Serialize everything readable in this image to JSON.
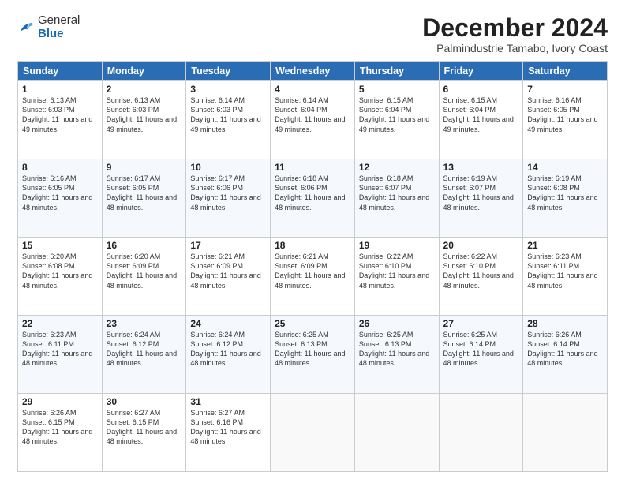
{
  "logo": {
    "general": "General",
    "blue": "Blue"
  },
  "header": {
    "title": "December 2024",
    "subtitle": "Palmindustrie Tamabo, Ivory Coast"
  },
  "weekdays": [
    "Sunday",
    "Monday",
    "Tuesday",
    "Wednesday",
    "Thursday",
    "Friday",
    "Saturday"
  ],
  "weeks": [
    [
      {
        "day": "1",
        "sunrise": "6:13 AM",
        "sunset": "6:03 PM",
        "daylight": "11 hours and 49 minutes."
      },
      {
        "day": "2",
        "sunrise": "6:13 AM",
        "sunset": "6:03 PM",
        "daylight": "11 hours and 49 minutes."
      },
      {
        "day": "3",
        "sunrise": "6:14 AM",
        "sunset": "6:03 PM",
        "daylight": "11 hours and 49 minutes."
      },
      {
        "day": "4",
        "sunrise": "6:14 AM",
        "sunset": "6:04 PM",
        "daylight": "11 hours and 49 minutes."
      },
      {
        "day": "5",
        "sunrise": "6:15 AM",
        "sunset": "6:04 PM",
        "daylight": "11 hours and 49 minutes."
      },
      {
        "day": "6",
        "sunrise": "6:15 AM",
        "sunset": "6:04 PM",
        "daylight": "11 hours and 49 minutes."
      },
      {
        "day": "7",
        "sunrise": "6:16 AM",
        "sunset": "6:05 PM",
        "daylight": "11 hours and 49 minutes."
      }
    ],
    [
      {
        "day": "8",
        "sunrise": "6:16 AM",
        "sunset": "6:05 PM",
        "daylight": "11 hours and 48 minutes."
      },
      {
        "day": "9",
        "sunrise": "6:17 AM",
        "sunset": "6:05 PM",
        "daylight": "11 hours and 48 minutes."
      },
      {
        "day": "10",
        "sunrise": "6:17 AM",
        "sunset": "6:06 PM",
        "daylight": "11 hours and 48 minutes."
      },
      {
        "day": "11",
        "sunrise": "6:18 AM",
        "sunset": "6:06 PM",
        "daylight": "11 hours and 48 minutes."
      },
      {
        "day": "12",
        "sunrise": "6:18 AM",
        "sunset": "6:07 PM",
        "daylight": "11 hours and 48 minutes."
      },
      {
        "day": "13",
        "sunrise": "6:19 AM",
        "sunset": "6:07 PM",
        "daylight": "11 hours and 48 minutes."
      },
      {
        "day": "14",
        "sunrise": "6:19 AM",
        "sunset": "6:08 PM",
        "daylight": "11 hours and 48 minutes."
      }
    ],
    [
      {
        "day": "15",
        "sunrise": "6:20 AM",
        "sunset": "6:08 PM",
        "daylight": "11 hours and 48 minutes."
      },
      {
        "day": "16",
        "sunrise": "6:20 AM",
        "sunset": "6:09 PM",
        "daylight": "11 hours and 48 minutes."
      },
      {
        "day": "17",
        "sunrise": "6:21 AM",
        "sunset": "6:09 PM",
        "daylight": "11 hours and 48 minutes."
      },
      {
        "day": "18",
        "sunrise": "6:21 AM",
        "sunset": "6:09 PM",
        "daylight": "11 hours and 48 minutes."
      },
      {
        "day": "19",
        "sunrise": "6:22 AM",
        "sunset": "6:10 PM",
        "daylight": "11 hours and 48 minutes."
      },
      {
        "day": "20",
        "sunrise": "6:22 AM",
        "sunset": "6:10 PM",
        "daylight": "11 hours and 48 minutes."
      },
      {
        "day": "21",
        "sunrise": "6:23 AM",
        "sunset": "6:11 PM",
        "daylight": "11 hours and 48 minutes."
      }
    ],
    [
      {
        "day": "22",
        "sunrise": "6:23 AM",
        "sunset": "6:11 PM",
        "daylight": "11 hours and 48 minutes."
      },
      {
        "day": "23",
        "sunrise": "6:24 AM",
        "sunset": "6:12 PM",
        "daylight": "11 hours and 48 minutes."
      },
      {
        "day": "24",
        "sunrise": "6:24 AM",
        "sunset": "6:12 PM",
        "daylight": "11 hours and 48 minutes."
      },
      {
        "day": "25",
        "sunrise": "6:25 AM",
        "sunset": "6:13 PM",
        "daylight": "11 hours and 48 minutes."
      },
      {
        "day": "26",
        "sunrise": "6:25 AM",
        "sunset": "6:13 PM",
        "daylight": "11 hours and 48 minutes."
      },
      {
        "day": "27",
        "sunrise": "6:25 AM",
        "sunset": "6:14 PM",
        "daylight": "11 hours and 48 minutes."
      },
      {
        "day": "28",
        "sunrise": "6:26 AM",
        "sunset": "6:14 PM",
        "daylight": "11 hours and 48 minutes."
      }
    ],
    [
      {
        "day": "29",
        "sunrise": "6:26 AM",
        "sunset": "6:15 PM",
        "daylight": "11 hours and 48 minutes."
      },
      {
        "day": "30",
        "sunrise": "6:27 AM",
        "sunset": "6:15 PM",
        "daylight": "11 hours and 48 minutes."
      },
      {
        "day": "31",
        "sunrise": "6:27 AM",
        "sunset": "6:16 PM",
        "daylight": "11 hours and 48 minutes."
      },
      null,
      null,
      null,
      null
    ]
  ]
}
